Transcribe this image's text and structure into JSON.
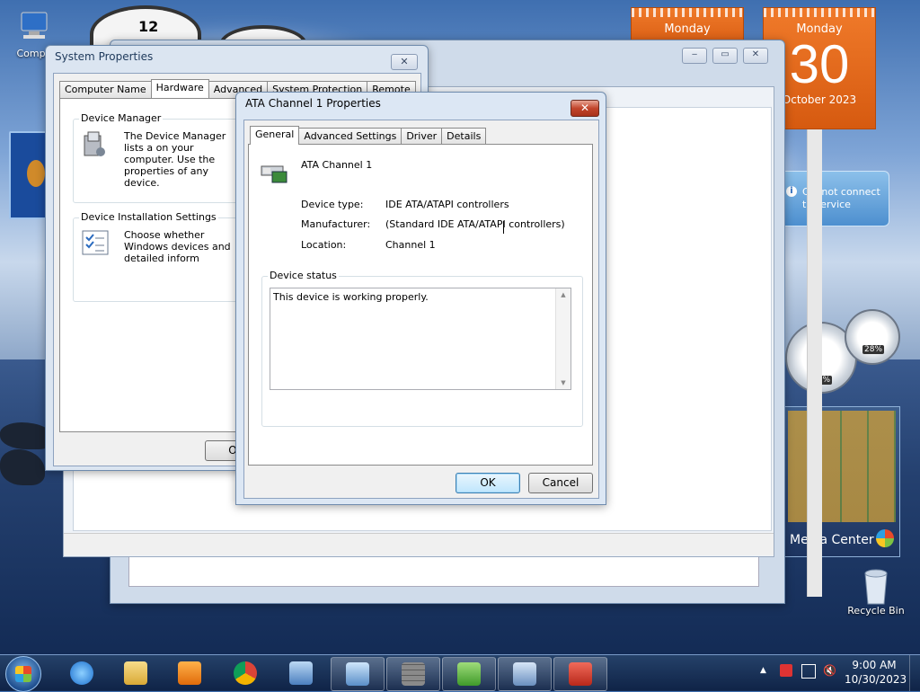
{
  "desktop": {
    "icons": [
      {
        "label": "Compu"
      },
      {
        "label": "Recycle Bin"
      }
    ],
    "calendar_small": {
      "day": "Monday"
    },
    "calendar_large": {
      "day": "Monday",
      "date": "30",
      "month_year": "October 2023"
    },
    "weather": {
      "message": "Cannot connect to service"
    },
    "cpu_meter": {
      "cpu": "02%",
      "memory": "28%"
    },
    "media_center": {
      "label": "Media Center"
    }
  },
  "system_properties": {
    "title": "System Properties",
    "tabs": [
      "Computer Name",
      "Hardware",
      "Advanced",
      "System Protection",
      "Remote"
    ],
    "active_tab": "Hardware",
    "device_manager": {
      "heading": "Device Manager",
      "text": "The Device Manager lists a on your computer. Use the properties of any device."
    },
    "device_installation": {
      "heading": "Device Installation Settings",
      "text": "Choose whether Windows devices and detailed inform"
    },
    "ok_button": "O"
  },
  "dialog": {
    "title": "ATA Channel 1 Properties",
    "tabs": [
      "General",
      "Advanced Settings",
      "Driver",
      "Details"
    ],
    "active_tab": "General",
    "device_name": "ATA Channel 1",
    "fields": [
      {
        "label": "Device type:",
        "value": "IDE ATA/ATAPI controllers"
      },
      {
        "label": "Manufacturer:",
        "value": "(Standard IDE ATA/ATAPI controllers)"
      },
      {
        "label": "Location:",
        "value": "Channel 1"
      }
    ],
    "status_group": "Device status",
    "status_text": "This device is working properly.",
    "ok": "OK",
    "cancel": "Cancel"
  },
  "taskbar": {
    "time": "9:00 AM",
    "date": "10/30/2023"
  }
}
